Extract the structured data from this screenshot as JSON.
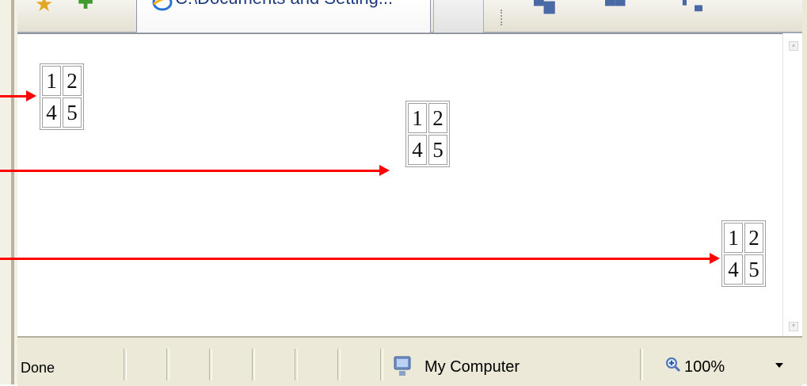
{
  "tab": {
    "title": "C:\\Documents and Setting..."
  },
  "tables": [
    {
      "cells": [
        [
          "1",
          "2"
        ],
        [
          "4",
          "5"
        ]
      ]
    },
    {
      "cells": [
        [
          "1",
          "2"
        ],
        [
          "4",
          "5"
        ]
      ]
    },
    {
      "cells": [
        [
          "1",
          "2"
        ],
        [
          "4",
          "5"
        ]
      ]
    }
  ],
  "statusbar": {
    "status": "Done",
    "zone": "My Computer",
    "zoom": "100%"
  },
  "colors": {
    "arrow": "#ff0000",
    "tab_text": "#1e3b80",
    "chrome": "#ece9d8"
  },
  "icons": [
    "favorites-star-icon",
    "add-favorites-icon",
    "ie-page-icon",
    "home-icon",
    "feeds-icon",
    "print-icon",
    "computer-icon",
    "zoom-icon"
  ]
}
